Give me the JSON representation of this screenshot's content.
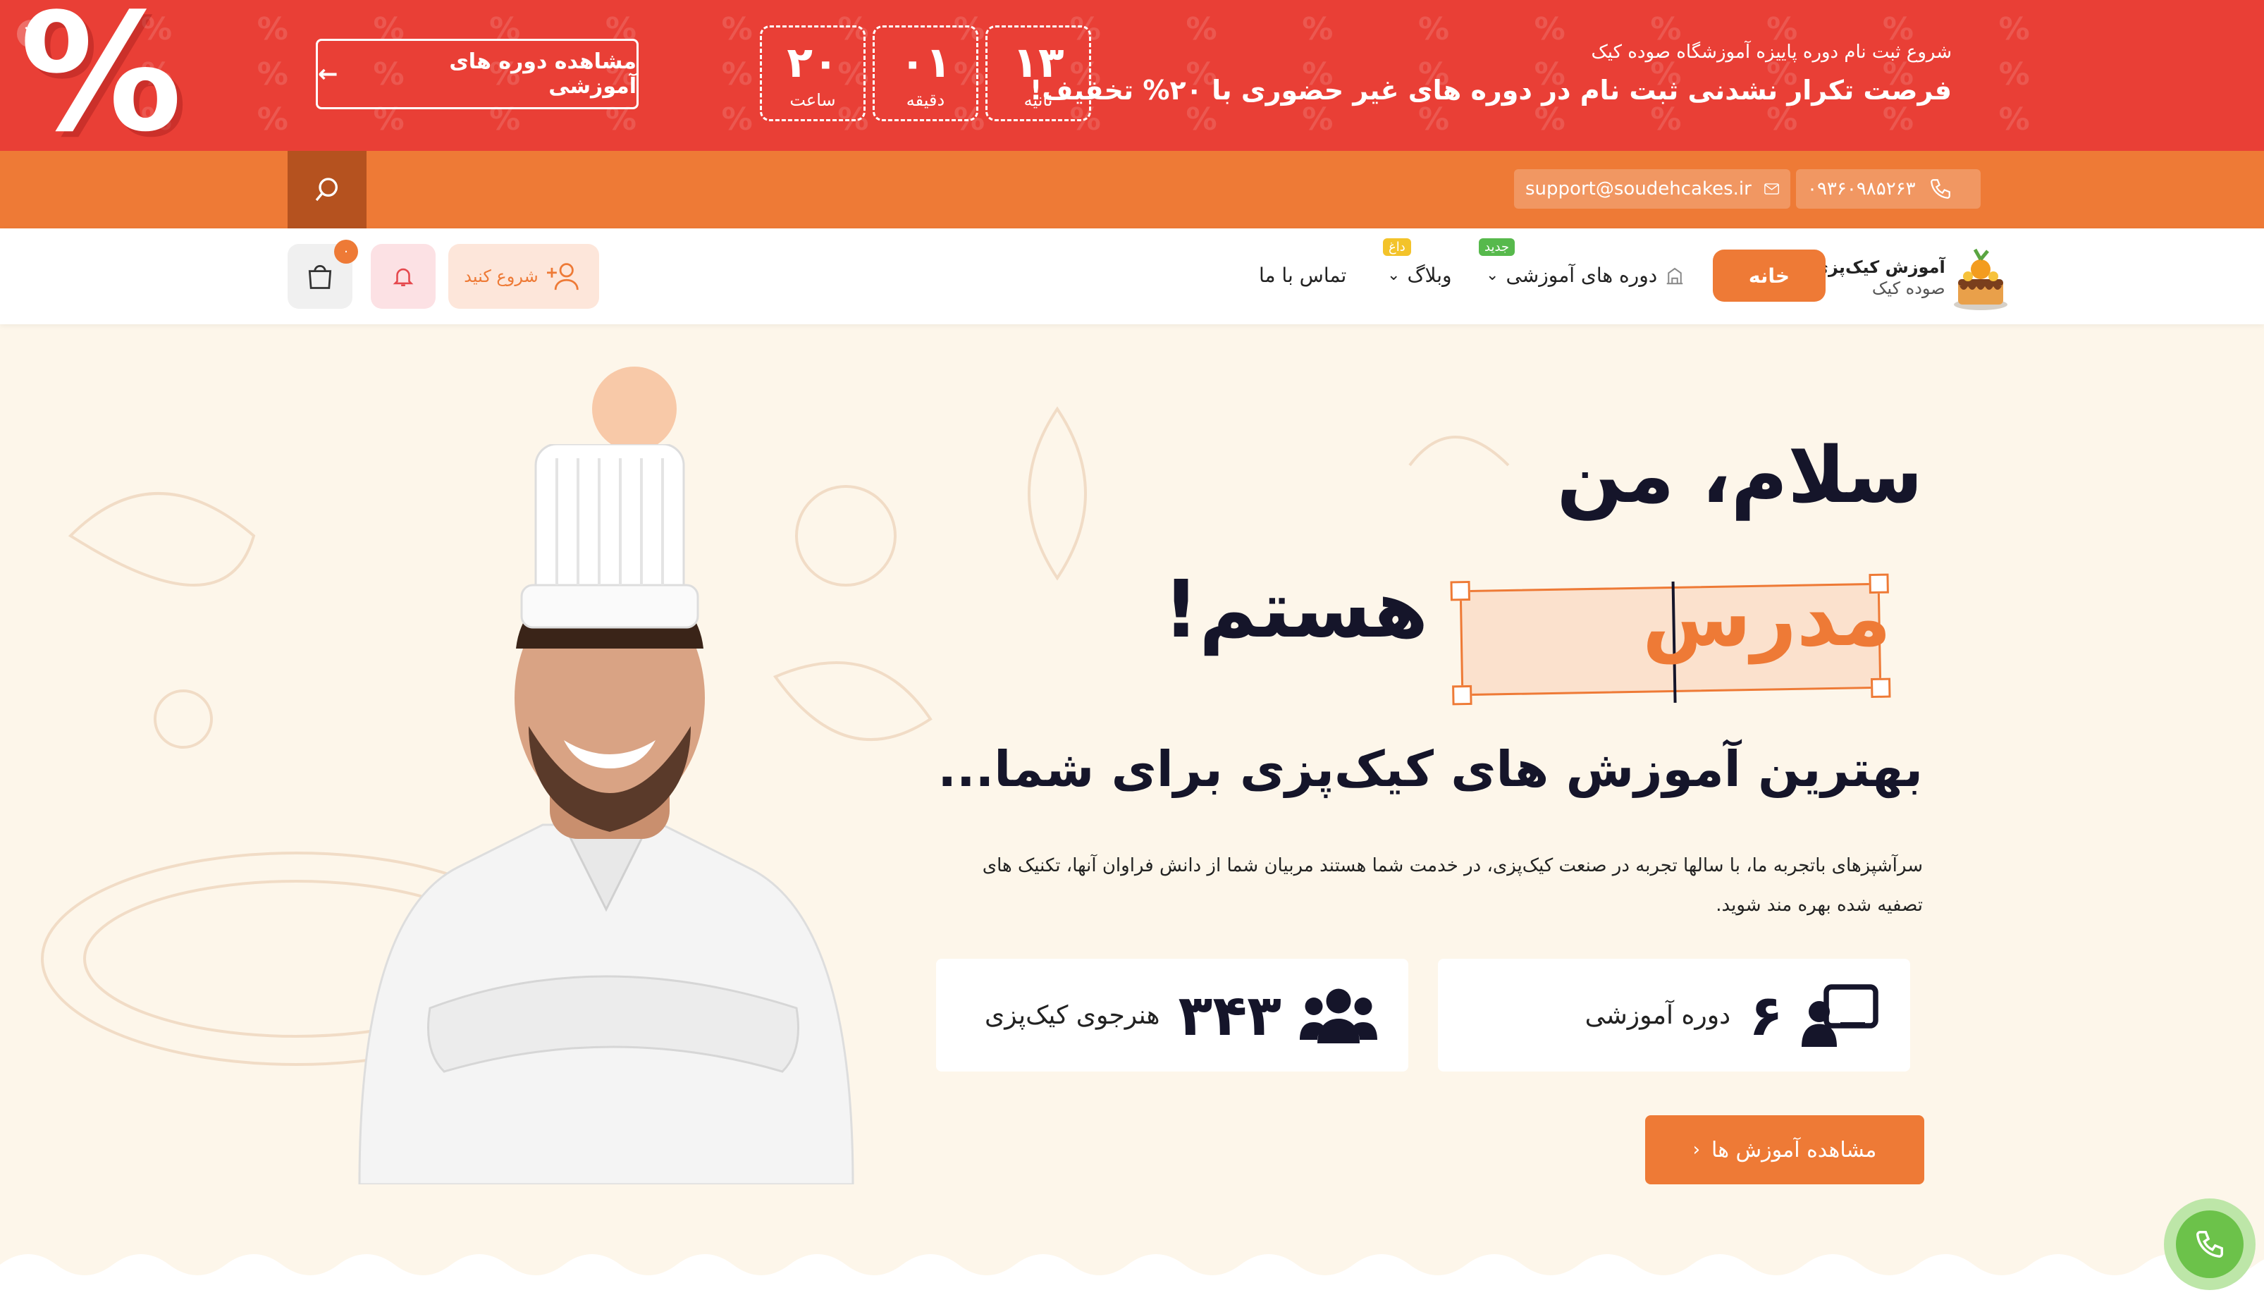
{
  "promo": {
    "percent_sign": "%",
    "close": "×",
    "view_button": "مشاهده دوره های آموزشی",
    "timer": [
      {
        "value": "۲۰",
        "label": "ساعت"
      },
      {
        "value": "۰۱",
        "label": "دقیقه"
      },
      {
        "value": "۱۳",
        "label": "ثانیه"
      }
    ],
    "small_text": "شروع ثبت نام دوره پاییزه آموزشگاه صوده کیک",
    "big_text": "فرصت تکرار نشدنی ثبت نام در دوره های غیر حضوری با ۲۰% تخفیف!",
    "color": "#e93f36"
  },
  "topbar": {
    "phone": "۰۹۳۶۰۹۸۵۲۶۳",
    "email": "support@soudehcakes.ir",
    "color": "#ee7a36"
  },
  "nav": {
    "logo_line1": "آموزش کیک‌پزی",
    "logo_line2": "صوده کیک",
    "home": "خانه",
    "courses": "دوره های آموزشی",
    "courses_badge": "جدید",
    "blog": "وبلاگ",
    "blog_badge": "داغ",
    "contact": "تماس با ما",
    "start": "شروع کنید",
    "cart_count": "۰"
  },
  "hero": {
    "greeting": "سلام، من",
    "role": "مدرس",
    "am": "هستم!",
    "subtitle": "بهترین آموزش های کیک‌پزی برای شما...",
    "description": "سرآشپزهای باتجربه ما، با سالها تجربه در صنعت کیک‌پزی، در خدمت شما هستند مربیان شما از دانش فراوان آنها، تکنیک های تصفیه شده بهره مند شوید.",
    "stats": [
      {
        "value": "۶",
        "label": "دوره آموزشی",
        "icon": "teacher-board-icon"
      },
      {
        "value": "۳۴۳",
        "label": "هنرجوی کیک‌پزی",
        "icon": "users-group-icon"
      }
    ],
    "cta": "مشاهده آموزش ها",
    "accent": "#ee7a36"
  }
}
